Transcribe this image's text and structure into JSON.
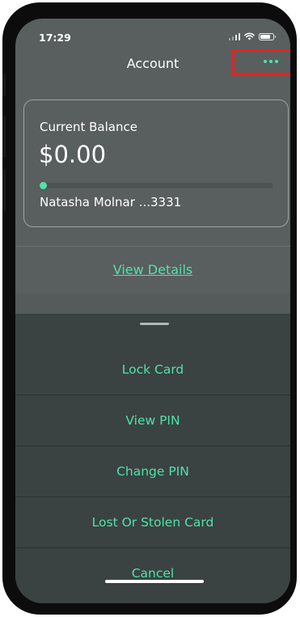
{
  "status_bar": {
    "time": "17:29"
  },
  "header": {
    "title": "Account",
    "more_icon": "more-dots-icon"
  },
  "balance_card": {
    "label": "Current Balance",
    "amount": "$0.00",
    "progress_fraction": 0.0,
    "holder": "Natasha Molnar ...3331"
  },
  "view_details": {
    "label": "View Details"
  },
  "action_sheet": {
    "items": [
      {
        "label": "Lock Card"
      },
      {
        "label": "View PIN"
      },
      {
        "label": "Change PIN"
      },
      {
        "label": "Lost Or Stolen Card"
      },
      {
        "label": "Cancel"
      }
    ]
  },
  "colors": {
    "accent": "#4fe3a9",
    "highlight": "#e8221e",
    "sheet_background": "#3b4242",
    "screen_background": "#595e5f"
  }
}
